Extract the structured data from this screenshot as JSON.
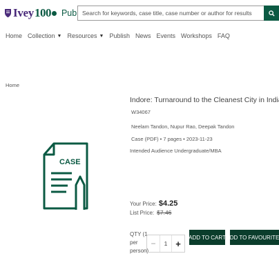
{
  "header": {
    "logo": {
      "brand": "Ivey",
      "number": "100",
      "publishing": "Publishing"
    },
    "search": {
      "placeholder": "Search for keywords, case title, case number or author for results"
    },
    "search_icon": "search-icon"
  },
  "nav": {
    "items": [
      {
        "label": "Home",
        "dropdown": false
      },
      {
        "label": "Collection",
        "dropdown": true
      },
      {
        "label": "Resources",
        "dropdown": true
      },
      {
        "label": "Publish",
        "dropdown": false
      },
      {
        "label": "News",
        "dropdown": false
      },
      {
        "label": "Events",
        "dropdown": false
      },
      {
        "label": "Workshops",
        "dropdown": false
      },
      {
        "label": "FAQ",
        "dropdown": false
      }
    ]
  },
  "breadcrumb": "Home",
  "product": {
    "title": "Indore: Turnaround to the Cleanest City in India",
    "code": "W34067",
    "authors": "Neelam Tandon, Nupur Rao, Deepak Tandon",
    "details": "Case (PDF) • 7 pages • 2023-11-23",
    "audience": "Intended Audience Undergraduate/MBA",
    "icon_label": "CASE",
    "your_price_label": "Your Price:",
    "your_price": "$4.25",
    "list_price_label": "List Price:",
    "list_price": "$7.46",
    "qty_label": "QTY (1 per person)",
    "qty_value": "1",
    "qty_minus": "−",
    "qty_plus": "+",
    "add_to_cart": "ADD TO CART",
    "add_to_favourites": "ADD TO FAVOURITES"
  },
  "colors": {
    "brand_green": "#0b5a43",
    "button_dark": "#0b3d2c",
    "brand_purple": "#4a2a7a"
  }
}
